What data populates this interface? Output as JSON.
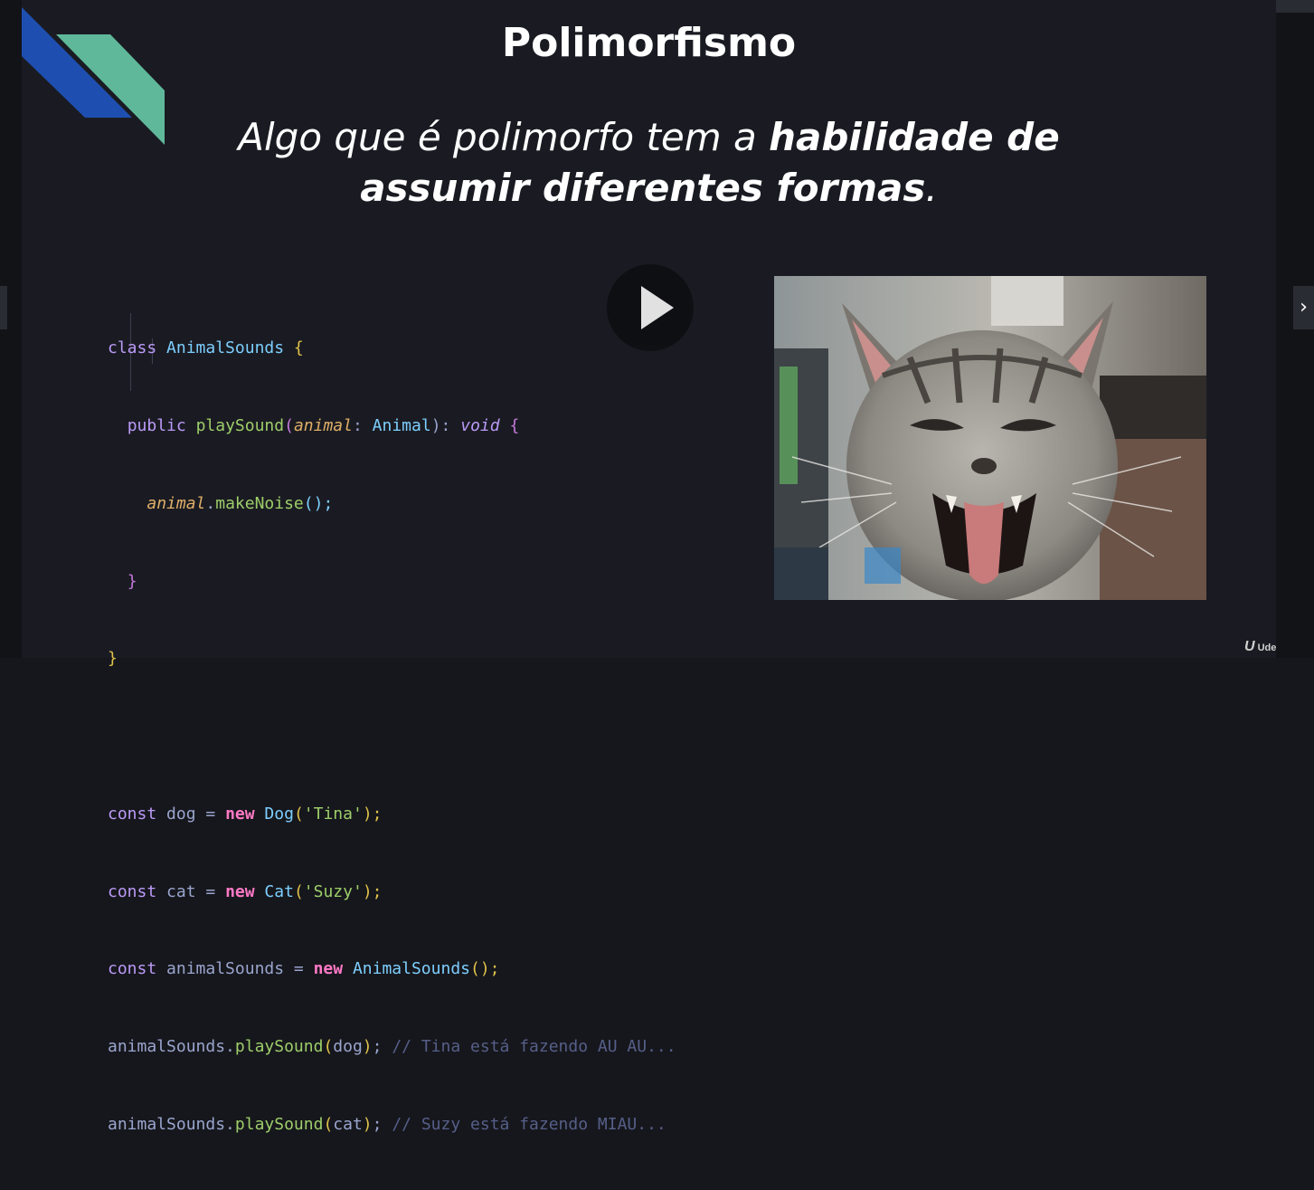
{
  "slide": {
    "title": "Polimorfismo",
    "subtitle_line1_normal": "Algo que é polimorfo tem a ",
    "subtitle_line1_bold": "habilidade de",
    "subtitle_line2_bold": "assumir diferentes formas",
    "subtitle_line2_end": "."
  },
  "code": {
    "l1": {
      "kw": "class",
      "cls": "AnimalSounds",
      "open": "{"
    },
    "l2": {
      "kw": "public",
      "fn": "playSound",
      "param": "animal",
      "colon": ":",
      "type": "Animal",
      "sig_end": "):",
      "ret": "void",
      "open": "{"
    },
    "l3": {
      "param": "animal",
      "dot": ".",
      "fn": "makeNoise",
      "call": "();"
    },
    "l4": {
      "close": "}"
    },
    "l5": {
      "close": "}"
    },
    "l7": {
      "kw": "const",
      "name": "dog =",
      "new": "new",
      "cls": "Dog",
      "str": "'Tina'",
      "end": ");"
    },
    "l8": {
      "kw": "const",
      "name": "cat =",
      "new": "new",
      "cls": "Cat",
      "str": "'Suzy'",
      "end": ");"
    },
    "l9": {
      "kw": "const",
      "name": "animalSounds =",
      "new": "new",
      "cls": "AnimalSounds",
      "end": "();"
    },
    "l10": {
      "obj": "animalSounds",
      "fn": "playSound",
      "arg": "dog",
      "comment": "// Tina está fazendo AU AU..."
    },
    "l11": {
      "obj": "animalSounds",
      "fn": "playSound",
      "arg": "cat",
      "comment": "// Suzy está fazendo MIAU..."
    }
  },
  "player": {
    "brand": "Udemy",
    "play_icon": "play-icon",
    "next_icon": "chevron-right-icon"
  },
  "colors": {
    "background": "#1a1b22",
    "logo_blue": "#1e4fb0",
    "logo_teal": "#5fb89a"
  }
}
